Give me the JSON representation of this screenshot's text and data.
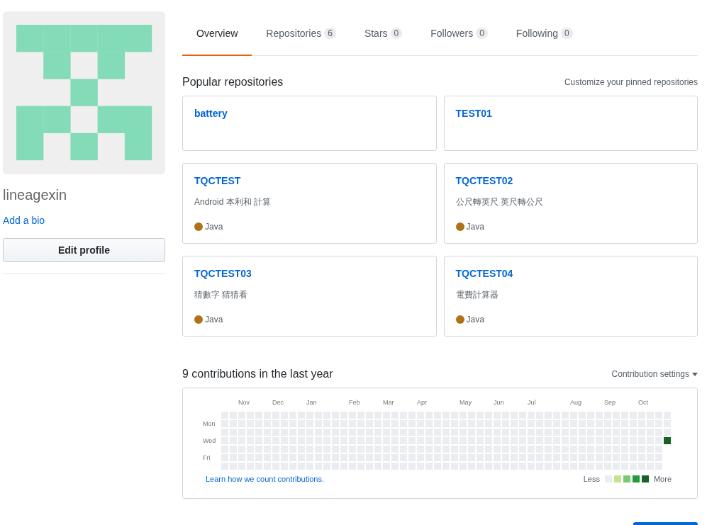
{
  "profile": {
    "username": "lineagexin",
    "bio_link": "Add a bio",
    "edit_button": "Edit profile"
  },
  "tabs": [
    {
      "label": "Overview",
      "selected": true
    },
    {
      "label": "Repositories",
      "count": "6",
      "selected": false
    },
    {
      "label": "Stars",
      "count": "0",
      "selected": false
    },
    {
      "label": "Followers",
      "count": "0",
      "selected": false
    },
    {
      "label": "Following",
      "count": "0",
      "selected": false
    }
  ],
  "popular": {
    "title": "Popular repositories",
    "customize_link": "Customize your pinned repositories",
    "repos": [
      {
        "name": "battery"
      },
      {
        "name": "TEST01"
      },
      {
        "name": "TQCTEST",
        "description": "Android 本利和 計算",
        "language": "Java",
        "color": "#b07219"
      },
      {
        "name": "TQCTEST02",
        "description": "公尺轉英尺 英尺轉公尺",
        "language": "Java",
        "color": "#b07219"
      },
      {
        "name": "TQCTEST03",
        "description": "猜數字 猜猜看",
        "language": "Java",
        "color": "#b07219"
      },
      {
        "name": "TQCTEST04",
        "description": "電費計算器",
        "language": "Java",
        "color": "#b07219"
      }
    ]
  },
  "contributions": {
    "title": "9 contributions in the last year",
    "settings": "Contribution settings",
    "months": [
      "Nov",
      "Dec",
      "Jan",
      "Feb",
      "Mar",
      "Apr",
      "May",
      "Jun",
      "Jul",
      "Aug",
      "Sep",
      "Oct"
    ],
    "days": [
      "Mon",
      "Wed",
      "Fri"
    ],
    "learn_link": "Learn how we count contributions.",
    "less": "Less",
    "more": "More",
    "legend": [
      {
        "color": "#ebedf0"
      },
      {
        "color": "#c6e48b"
      },
      {
        "color": "#7bc96f"
      },
      {
        "color": "#239a3b"
      },
      {
        "color": "#196127"
      }
    ]
  }
}
